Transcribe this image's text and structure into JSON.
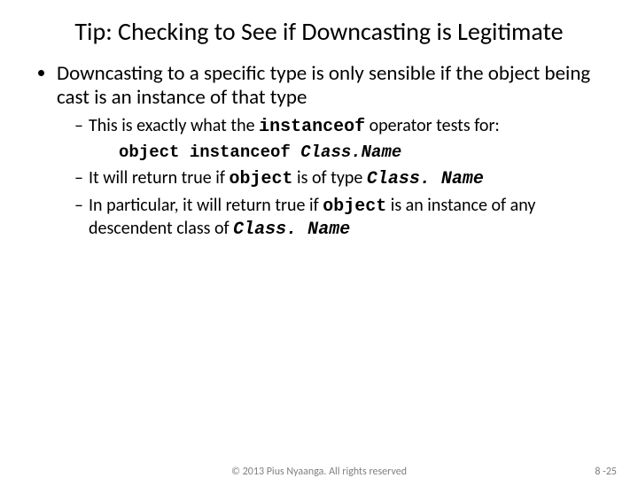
{
  "title": "Tip:  Checking to See if Downcasting is Legitimate",
  "bullet1": "Downcasting to a specific type is only sensible if the object being cast is an instance of that type",
  "sub1_a": "This is exactly what the ",
  "sub1_b": "instanceof",
  "sub1_c": " operator tests for:",
  "code_a": "object instanceof ",
  "code_b": "Class.Name",
  "sub2_a": "It will return true if ",
  "sub2_b": "object",
  "sub2_c": " is of type ",
  "sub2_d": "Class. Name",
  "sub3_a": "In particular, it will return true if ",
  "sub3_b": "object",
  "sub3_c": " is an instance of any descendent class of ",
  "sub3_d": "Class. Name",
  "copyright": "© 2013 Pius Nyaanga. All rights reserved",
  "pagenum": "8 -25"
}
